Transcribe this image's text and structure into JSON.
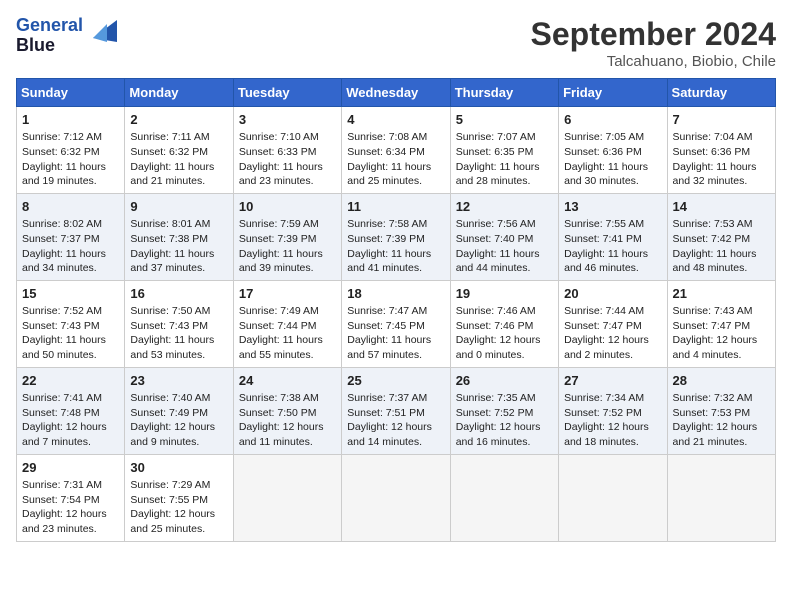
{
  "header": {
    "logo_line1": "General",
    "logo_line2": "Blue",
    "month_year": "September 2024",
    "location": "Talcahuano, Biobio, Chile"
  },
  "days_of_week": [
    "Sunday",
    "Monday",
    "Tuesday",
    "Wednesday",
    "Thursday",
    "Friday",
    "Saturday"
  ],
  "weeks": [
    [
      {
        "day": "1",
        "info": "Sunrise: 7:12 AM\nSunset: 6:32 PM\nDaylight: 11 hours\nand 19 minutes."
      },
      {
        "day": "2",
        "info": "Sunrise: 7:11 AM\nSunset: 6:32 PM\nDaylight: 11 hours\nand 21 minutes."
      },
      {
        "day": "3",
        "info": "Sunrise: 7:10 AM\nSunset: 6:33 PM\nDaylight: 11 hours\nand 23 minutes."
      },
      {
        "day": "4",
        "info": "Sunrise: 7:08 AM\nSunset: 6:34 PM\nDaylight: 11 hours\nand 25 minutes."
      },
      {
        "day": "5",
        "info": "Sunrise: 7:07 AM\nSunset: 6:35 PM\nDaylight: 11 hours\nand 28 minutes."
      },
      {
        "day": "6",
        "info": "Sunrise: 7:05 AM\nSunset: 6:36 PM\nDaylight: 11 hours\nand 30 minutes."
      },
      {
        "day": "7",
        "info": "Sunrise: 7:04 AM\nSunset: 6:36 PM\nDaylight: 11 hours\nand 32 minutes."
      }
    ],
    [
      {
        "day": "8",
        "info": "Sunrise: 8:02 AM\nSunset: 7:37 PM\nDaylight: 11 hours\nand 34 minutes."
      },
      {
        "day": "9",
        "info": "Sunrise: 8:01 AM\nSunset: 7:38 PM\nDaylight: 11 hours\nand 37 minutes."
      },
      {
        "day": "10",
        "info": "Sunrise: 7:59 AM\nSunset: 7:39 PM\nDaylight: 11 hours\nand 39 minutes."
      },
      {
        "day": "11",
        "info": "Sunrise: 7:58 AM\nSunset: 7:39 PM\nDaylight: 11 hours\nand 41 minutes."
      },
      {
        "day": "12",
        "info": "Sunrise: 7:56 AM\nSunset: 7:40 PM\nDaylight: 11 hours\nand 44 minutes."
      },
      {
        "day": "13",
        "info": "Sunrise: 7:55 AM\nSunset: 7:41 PM\nDaylight: 11 hours\nand 46 minutes."
      },
      {
        "day": "14",
        "info": "Sunrise: 7:53 AM\nSunset: 7:42 PM\nDaylight: 11 hours\nand 48 minutes."
      }
    ],
    [
      {
        "day": "15",
        "info": "Sunrise: 7:52 AM\nSunset: 7:43 PM\nDaylight: 11 hours\nand 50 minutes."
      },
      {
        "day": "16",
        "info": "Sunrise: 7:50 AM\nSunset: 7:43 PM\nDaylight: 11 hours\nand 53 minutes."
      },
      {
        "day": "17",
        "info": "Sunrise: 7:49 AM\nSunset: 7:44 PM\nDaylight: 11 hours\nand 55 minutes."
      },
      {
        "day": "18",
        "info": "Sunrise: 7:47 AM\nSunset: 7:45 PM\nDaylight: 11 hours\nand 57 minutes."
      },
      {
        "day": "19",
        "info": "Sunrise: 7:46 AM\nSunset: 7:46 PM\nDaylight: 12 hours\nand 0 minutes."
      },
      {
        "day": "20",
        "info": "Sunrise: 7:44 AM\nSunset: 7:47 PM\nDaylight: 12 hours\nand 2 minutes."
      },
      {
        "day": "21",
        "info": "Sunrise: 7:43 AM\nSunset: 7:47 PM\nDaylight: 12 hours\nand 4 minutes."
      }
    ],
    [
      {
        "day": "22",
        "info": "Sunrise: 7:41 AM\nSunset: 7:48 PM\nDaylight: 12 hours\nand 7 minutes."
      },
      {
        "day": "23",
        "info": "Sunrise: 7:40 AM\nSunset: 7:49 PM\nDaylight: 12 hours\nand 9 minutes."
      },
      {
        "day": "24",
        "info": "Sunrise: 7:38 AM\nSunset: 7:50 PM\nDaylight: 12 hours\nand 11 minutes."
      },
      {
        "day": "25",
        "info": "Sunrise: 7:37 AM\nSunset: 7:51 PM\nDaylight: 12 hours\nand 14 minutes."
      },
      {
        "day": "26",
        "info": "Sunrise: 7:35 AM\nSunset: 7:52 PM\nDaylight: 12 hours\nand 16 minutes."
      },
      {
        "day": "27",
        "info": "Sunrise: 7:34 AM\nSunset: 7:52 PM\nDaylight: 12 hours\nand 18 minutes."
      },
      {
        "day": "28",
        "info": "Sunrise: 7:32 AM\nSunset: 7:53 PM\nDaylight: 12 hours\nand 21 minutes."
      }
    ],
    [
      {
        "day": "29",
        "info": "Sunrise: 7:31 AM\nSunset: 7:54 PM\nDaylight: 12 hours\nand 23 minutes."
      },
      {
        "day": "30",
        "info": "Sunrise: 7:29 AM\nSunset: 7:55 PM\nDaylight: 12 hours\nand 25 minutes."
      },
      null,
      null,
      null,
      null,
      null
    ]
  ]
}
